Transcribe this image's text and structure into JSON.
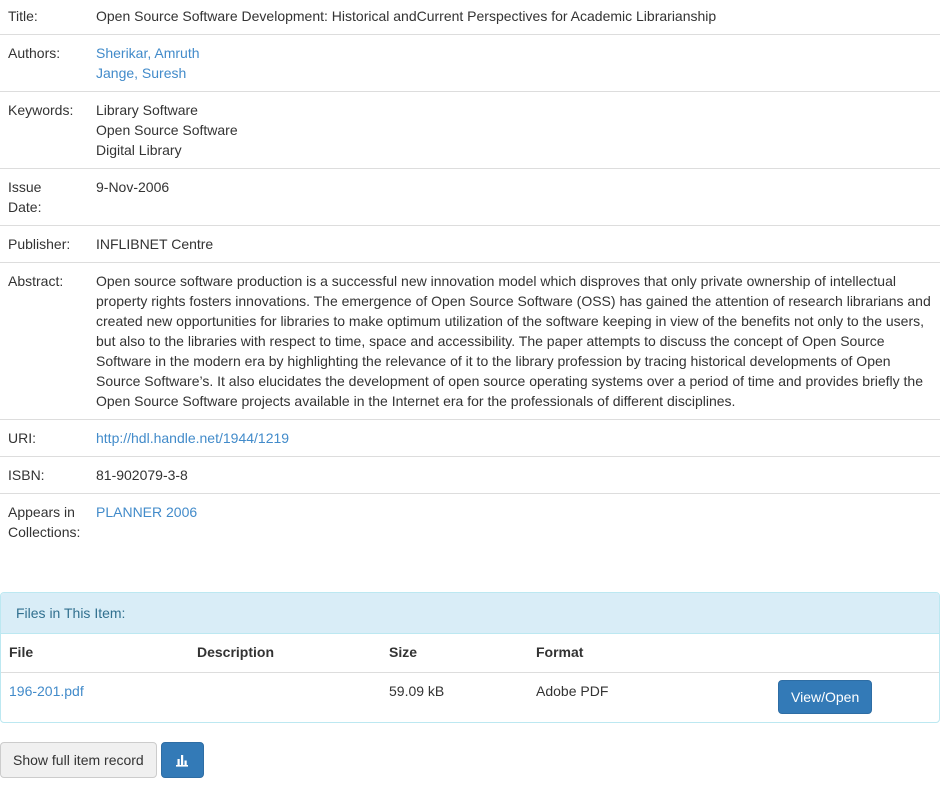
{
  "record": {
    "title_label": "Title:",
    "title": "Open Source Software Development: Historical andCurrent Perspectives for Academic Librarianship",
    "authors_label": "Authors:",
    "authors": [
      "Sherikar, Amruth",
      "Jange, Suresh"
    ],
    "keywords_label": "Keywords:",
    "keywords": [
      "Library Software",
      "Open Source Software",
      "Digital Library"
    ],
    "issue_date_label_1": "Issue",
    "issue_date_label_2": "Date:",
    "issue_date": "9-Nov-2006",
    "publisher_label": "Publisher:",
    "publisher": "INFLIBNET Centre",
    "abstract_label": "Abstract:",
    "abstract": "Open source software production is a successful new innovation model which disproves that only private ownership of intellectual property rights fosters innovations. The emergence of Open Source Software (OSS) has gained the attention of research librarians and created new opportunities for libraries to make optimum utilization of the software keeping in view of the benefits not only to the users, but also to the libraries with respect to time, space and accessibility. The paper attempts to discuss the concept of Open Source Software in the modern era by highlighting the relevance of it to the library profession by tracing historical developments of Open Source Software’s. It also elucidates the development of open source operating systems over a period of time and provides briefly the Open Source Software projects available in the Internet era for the professionals of different disciplines.",
    "uri_label": "URI:",
    "uri": "http://hdl.handle.net/1944/1219",
    "isbn_label": "ISBN:",
    "isbn": "81-902079-3-8",
    "collections_label_1": "Appears in",
    "collections_label_2": "Collections:",
    "collection": "PLANNER 2006"
  },
  "files": {
    "heading": "Files in This Item:",
    "columns": [
      "File",
      "Description",
      "Size",
      "Format"
    ],
    "rows": [
      {
        "file": "196-201.pdf",
        "description": "",
        "size": "59.09 kB",
        "format": "Adobe PDF",
        "action": "View/Open"
      }
    ]
  },
  "actions": {
    "full_record": "Show full item record",
    "stats_icon": "bar-chart-icon"
  },
  "colors": {
    "link": "#428bca",
    "primary": "#337ab7",
    "panel_heading_bg": "#d9edf7",
    "panel_heading_text": "#31708f"
  }
}
